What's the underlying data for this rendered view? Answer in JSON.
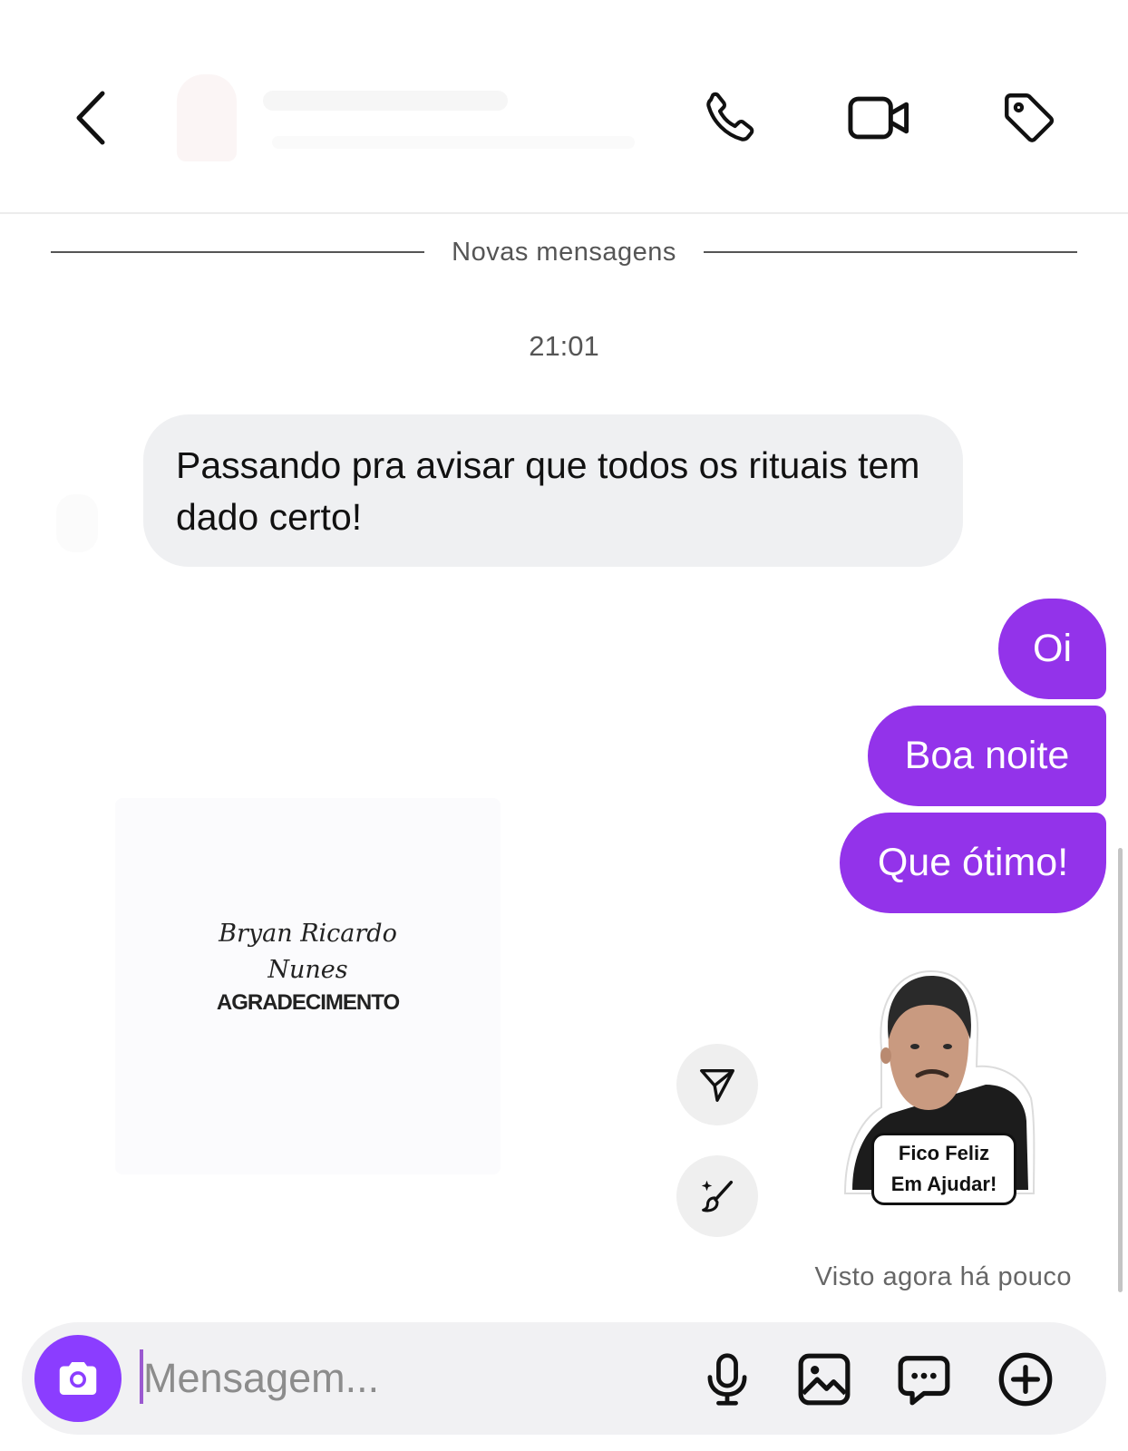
{
  "header": {
    "back_icon": "chevron-left-icon",
    "actions": [
      {
        "name": "voice-call",
        "icon": "phone-icon"
      },
      {
        "name": "video-call",
        "icon": "video-camera-icon"
      },
      {
        "name": "tag",
        "icon": "tag-icon"
      }
    ]
  },
  "conversation": {
    "divider_label": "Novas mensagens",
    "timestamp": "21:01",
    "incoming_message": "Passando pra avisar que todos os rituais tem dado certo!",
    "outgoing_messages": [
      "Oi",
      "Boa noite",
      "Que ótimo!"
    ],
    "image_card": {
      "script_line_1": "Bryan Ricardo",
      "script_line_2": "Nunes",
      "title": "AGRADECIMENTO"
    },
    "sticker": {
      "line_1": "Fico Feliz",
      "line_2": "Em Ajudar!"
    },
    "seen_status": "Visto agora há pouco"
  },
  "composer": {
    "placeholder": "Mensagem...",
    "tools": [
      "camera-icon",
      "microphone-icon",
      "image-icon",
      "chat-bubble-icon",
      "plus-circle-icon"
    ]
  },
  "colors": {
    "outgoing_bubble": "#9333ea",
    "camera_button": "#8b3dff",
    "incoming_bubble": "#eff0f2"
  }
}
